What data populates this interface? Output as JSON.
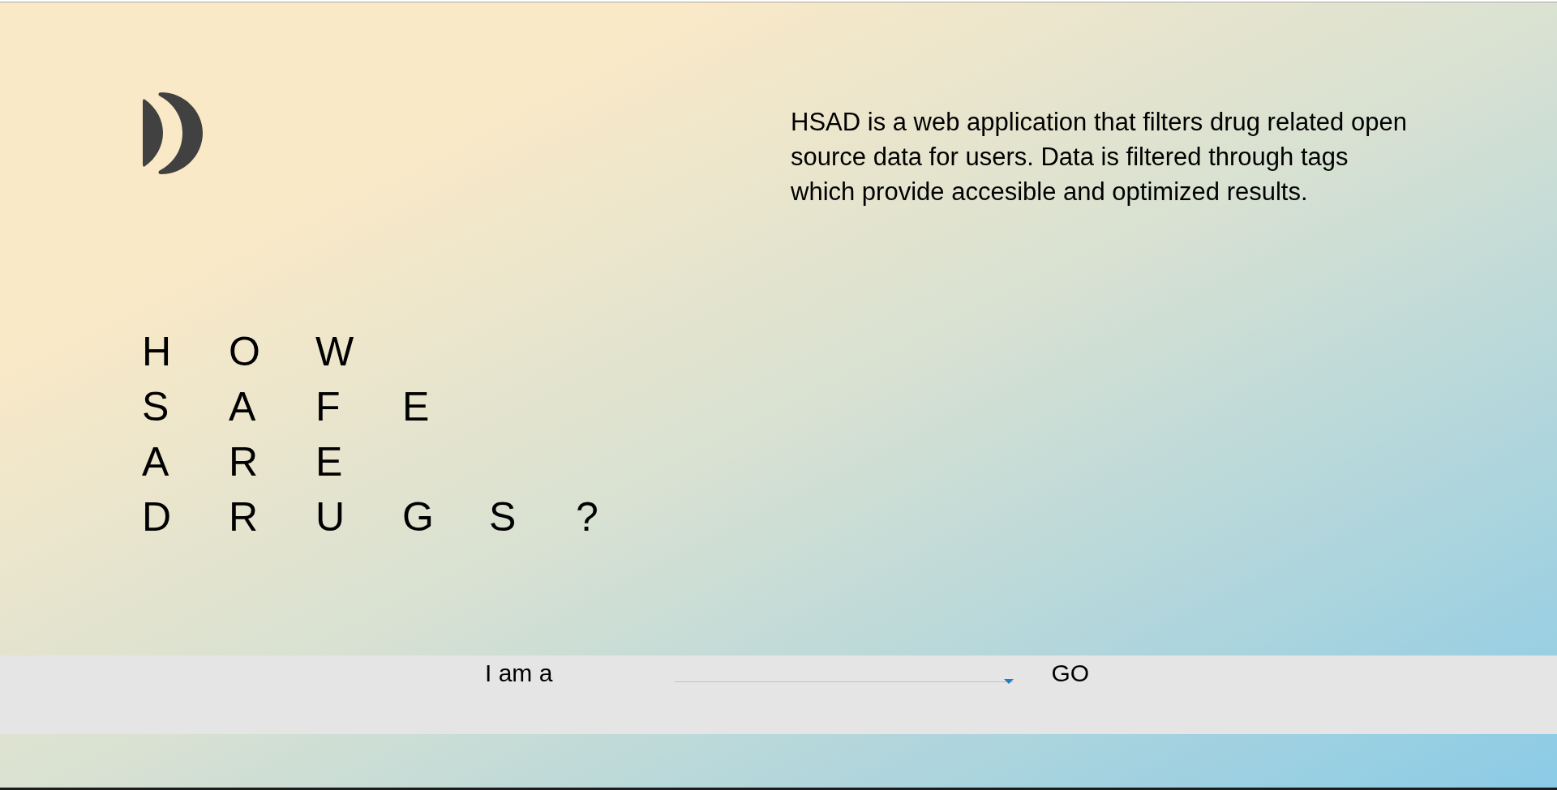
{
  "description": "HSAD is a web application that filters drug related open source data for users. Data is filtered through tags which provide accesible and optimized results.",
  "headline": [
    "H O W",
    "S A F E",
    "A R E",
    "D R U G S ?"
  ],
  "form": {
    "label": "I am a",
    "button": "GO"
  }
}
